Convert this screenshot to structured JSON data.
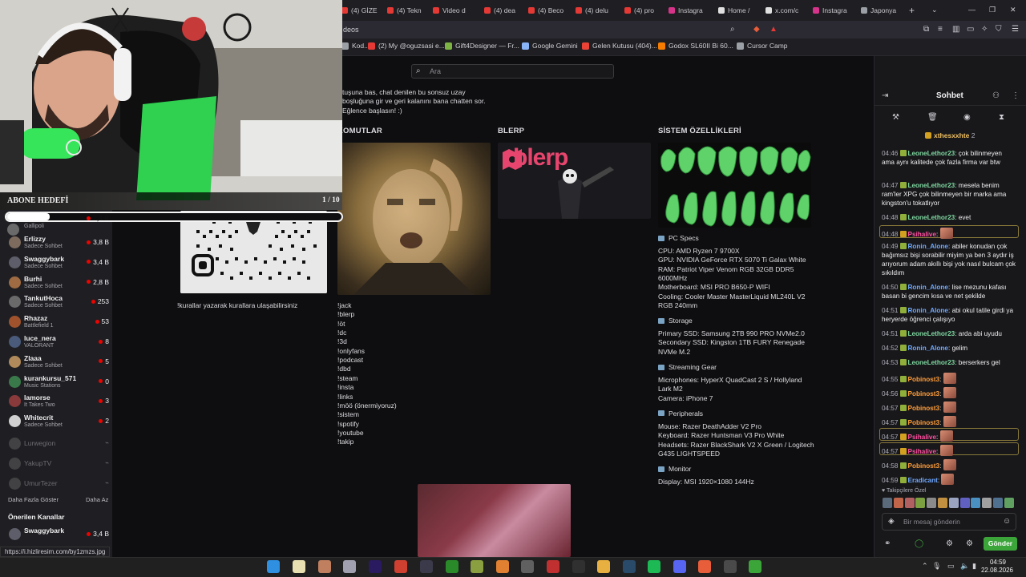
{
  "browser": {
    "tabs": [
      {
        "label": "(4) GİZE",
        "color": "#e53935"
      },
      {
        "label": "(4) Tekn",
        "color": "#e53935"
      },
      {
        "label": "Video d",
        "color": "#e53935"
      },
      {
        "label": "(4) dea",
        "color": "#e53935"
      },
      {
        "label": "(4) Beco",
        "color": "#e53935"
      },
      {
        "label": "(4) delu",
        "color": "#e53935"
      },
      {
        "label": "(4) pro",
        "color": "#e53935"
      },
      {
        "label": "Instagra",
        "color": "#d6338a"
      },
      {
        "label": "Home /",
        "color": "#e0e0e0"
      },
      {
        "label": "x.com/c",
        "color": "#e0e0e0"
      },
      {
        "label": "Instagra",
        "color": "#d6338a"
      },
      {
        "label": "Japonya",
        "color": "#9aa0a6"
      }
    ],
    "new_tab": "+",
    "address": "deos",
    "bookmarks": [
      {
        "label": "Kod...",
        "color": "#9aa0a6"
      },
      {
        "label": "(2) My @oguzsasi e...",
        "color": "#e53935"
      },
      {
        "label": "Gift4Designer — Fr...",
        "color": "#7cb342"
      },
      {
        "label": "Google Gemini",
        "color": "#8ab4f8"
      },
      {
        "label": "Gelen Kutusu (404)...",
        "color": "#ea4335"
      },
      {
        "label": "Godox SL60II Bi 60...",
        "color": "#f57c00"
      },
      {
        "label": "Cursor Camp",
        "color": "#9aa0a6"
      }
    ],
    "status_url": "https://i.hizliresim.com/by1zmzs.jpg"
  },
  "search": {
    "placeholder": "Ara"
  },
  "stream_overlay": {
    "goal_label": "ABONE HEDEFİ",
    "goal_count": "1 / 10",
    "goal_progress": 0.1
  },
  "sidebar": {
    "channels": [
      {
        "name": "Erlizzy",
        "game": "Sadece Sohbet",
        "viewers": "3,8 B",
        "color": "#7d6b5e"
      },
      {
        "name": "Swaggybark",
        "game": "Sadece Sohbet",
        "viewers": "3,4 B",
        "color": "#5e5e6a"
      },
      {
        "name": "Burhi",
        "game": "Sadece Sohbet",
        "viewers": "2,8 B",
        "color": "#9e6b42"
      },
      {
        "name": "TankutHoca",
        "game": "Sadece Sohbet",
        "viewers": "253",
        "color": "#6a6a6a"
      },
      {
        "name": "Rhazaz",
        "game": "Battlefield 1",
        "viewers": "53",
        "color": "#a0522d"
      },
      {
        "name": "luce_nera",
        "game": "VALORANT",
        "viewers": "8",
        "color": "#4a5a7a"
      },
      {
        "name": "Zlaaa",
        "game": "Sadece Sohbet",
        "viewers": "5",
        "color": "#b08a5a"
      },
      {
        "name": "kurankursu_571",
        "game": "Music Stations",
        "viewers": "0",
        "color": "#3a7a4a"
      },
      {
        "name": "lamorse",
        "game": "It Takes Two",
        "viewers": "3",
        "color": "#8a3a3a"
      },
      {
        "name": "Whitecrit",
        "game": "Sadece Sohbet",
        "viewers": "2",
        "color": "#d0d0d0"
      }
    ],
    "top_game": "Gallipoli",
    "top_viewers": "7,3 B",
    "offline": [
      "Lurwegion",
      "YakupTV",
      "UmurTezer"
    ],
    "show_more": "Daha Fazla Göster",
    "show_less": "Daha Az",
    "recommended_title": "Önerilen Kanallar",
    "recommended": [
      {
        "name": "Swaggybark",
        "viewers": "3,4 B"
      }
    ]
  },
  "panels": {
    "intro_lines": [
      "tuşuna bas, chat denilen bu sonsuz uzay",
      "boşluğuna gir ve geri kalanını bana chatten sor.",
      "Eğlence başlasın! :)"
    ],
    "rules_text": "!kurallar yazarak kurallara ulaşabilirsiniz",
    "commands_title": "KOMUTLAR",
    "blerp_title": "BLERP",
    "blerp_logo": "blerp",
    "system_title": "SİSTEM ÖZELLİKLERİ",
    "commands": [
      "!jack",
      "!blerp",
      "!öt",
      "!dc",
      "!3d",
      "!onlyfans",
      "!podcast",
      "!dbd",
      "!steam",
      "!insta",
      "!links",
      "!möö (önermiyoruz)",
      "!sistem",
      "!spotify",
      "!youtube",
      "!takip"
    ],
    "specs": [
      {
        "heading": "PC Specs",
        "lines": [
          "CPU: AMD Ryzen 7 9700X",
          "GPU: NVIDIA GeForce RTX 5070 Ti Galax White",
          "RAM: Patriot Viper Venom RGB 32GB DDR5",
          "6000MHz",
          "Motherboard: MSI PRO B650-P WIFI",
          "Cooling: Cooler Master MasterLiquid ML240L V2",
          "RGB 240mm"
        ]
      },
      {
        "heading": "Storage",
        "lines": [
          "Primary SSD: Samsung 2TB 990 PRO NVMe2.0",
          "Secondary SSD: Kingston 1TB FURY Renegade",
          "NVMe M.2"
        ]
      },
      {
        "heading": "Streaming Gear",
        "lines": [
          "Microphones: HyperX QuadCast 2 S / Hollyland",
          "Lark M2",
          "Camera: iPhone 7"
        ]
      },
      {
        "heading": "Peripherals",
        "lines": [
          "Mouse: Razer DeathAdder V2 Pro",
          "Keyboard: Razer Huntsman V3 Pro White",
          "Headsets: Razer BlackShark V2 X Green / Logitech",
          "G435 LIGHTSPEED"
        ]
      },
      {
        "heading": "Monitor",
        "lines": [
          "Display: MSI 1920×1080 144Hz"
        ]
      }
    ]
  },
  "chat": {
    "title": "Sohbet",
    "pinned_user": "xthesxxhte",
    "pinned_count": "2",
    "messages": [
      {
        "time": "04:46",
        "user": "LeoneLethor23",
        "color": "#7fd8a0",
        "text": "çok bilinmeyen",
        "cont": "ama aynı kalitede çok fazla firma var btw"
      },
      {
        "time": "04:47",
        "user": "LeoneLethor23",
        "color": "#7fd8a0",
        "text": "mesela benim",
        "cont": "ram'ler XPG çok bilinmeyen bir marka ama kingston'u tokatlıyor"
      },
      {
        "time": "04:48",
        "user": "LeoneLethor23",
        "color": "#7fd8a0",
        "text": "evet",
        "cont": ""
      },
      {
        "time": "04:48",
        "user": "Psihalive",
        "color": "#ff4fa0",
        "text": "",
        "cont": ""
      },
      {
        "time": "04:49",
        "user": "Ronin_Alone",
        "color": "#6fa8ff",
        "text": "abiler konudan çok",
        "cont": "bağımsız bişi sorabilir miyim ya ben 3 aydır iş arıyorum adam akıllı bişi yok nasıl bulcam çok sıkıldım"
      },
      {
        "time": "04:50",
        "user": "Ronin_Alone",
        "color": "#6fa8ff",
        "text": "lise mezunu kafası",
        "cont": "basan bi gencim kısa ve net şekilde"
      },
      {
        "time": "04:51",
        "user": "Ronin_Alone",
        "color": "#6fa8ff",
        "text": "abi okul tatile girdi ya",
        "cont": "heryerde öğrenci çalışıyo"
      },
      {
        "time": "04:51",
        "user": "LeoneLethor23",
        "color": "#7fd8a0",
        "text": "arda abi uyudu",
        "cont": ""
      },
      {
        "time": "04:52",
        "user": "Ronin_Alone",
        "color": "#6fa8ff",
        "text": "gelim",
        "cont": ""
      },
      {
        "time": "04:53",
        "user": "LeoneLethor23",
        "color": "#7fd8a0",
        "text": "berserkers gel",
        "cont": ""
      },
      {
        "time": "04:55",
        "user": "Pobinost3",
        "color": "#ff9d3a",
        "text": "",
        "cont": ""
      },
      {
        "time": "04:56",
        "user": "Pobinost3",
        "color": "#ff9d3a",
        "text": "",
        "cont": ""
      },
      {
        "time": "04:57",
        "user": "Pobinost3",
        "color": "#ff9d3a",
        "text": "",
        "cont": ""
      },
      {
        "time": "04:57",
        "user": "Pobinost3",
        "color": "#ff9d3a",
        "text": "",
        "cont": ""
      },
      {
        "time": "04:57",
        "user": "Psihalive",
        "color": "#ff4fa0",
        "text": "",
        "cont": ""
      },
      {
        "time": "04:57",
        "user": "Psihalive",
        "color": "#ff4fa0",
        "text": "",
        "cont": ""
      },
      {
        "time": "04:58",
        "user": "Pobinost3",
        "color": "#ff9d3a",
        "text": "",
        "cont": ""
      },
      {
        "time": "04:59",
        "user": "Eradicant",
        "color": "#6fa8ff",
        "text": "",
        "cont": ""
      }
    ],
    "followers_emotes_label": "Takipçilere Özel",
    "input_placeholder": "Bir mesaj gönderin",
    "send_label": "Gönder"
  },
  "taskbar": {
    "time": "04:59",
    "date": "22.08.2026"
  }
}
